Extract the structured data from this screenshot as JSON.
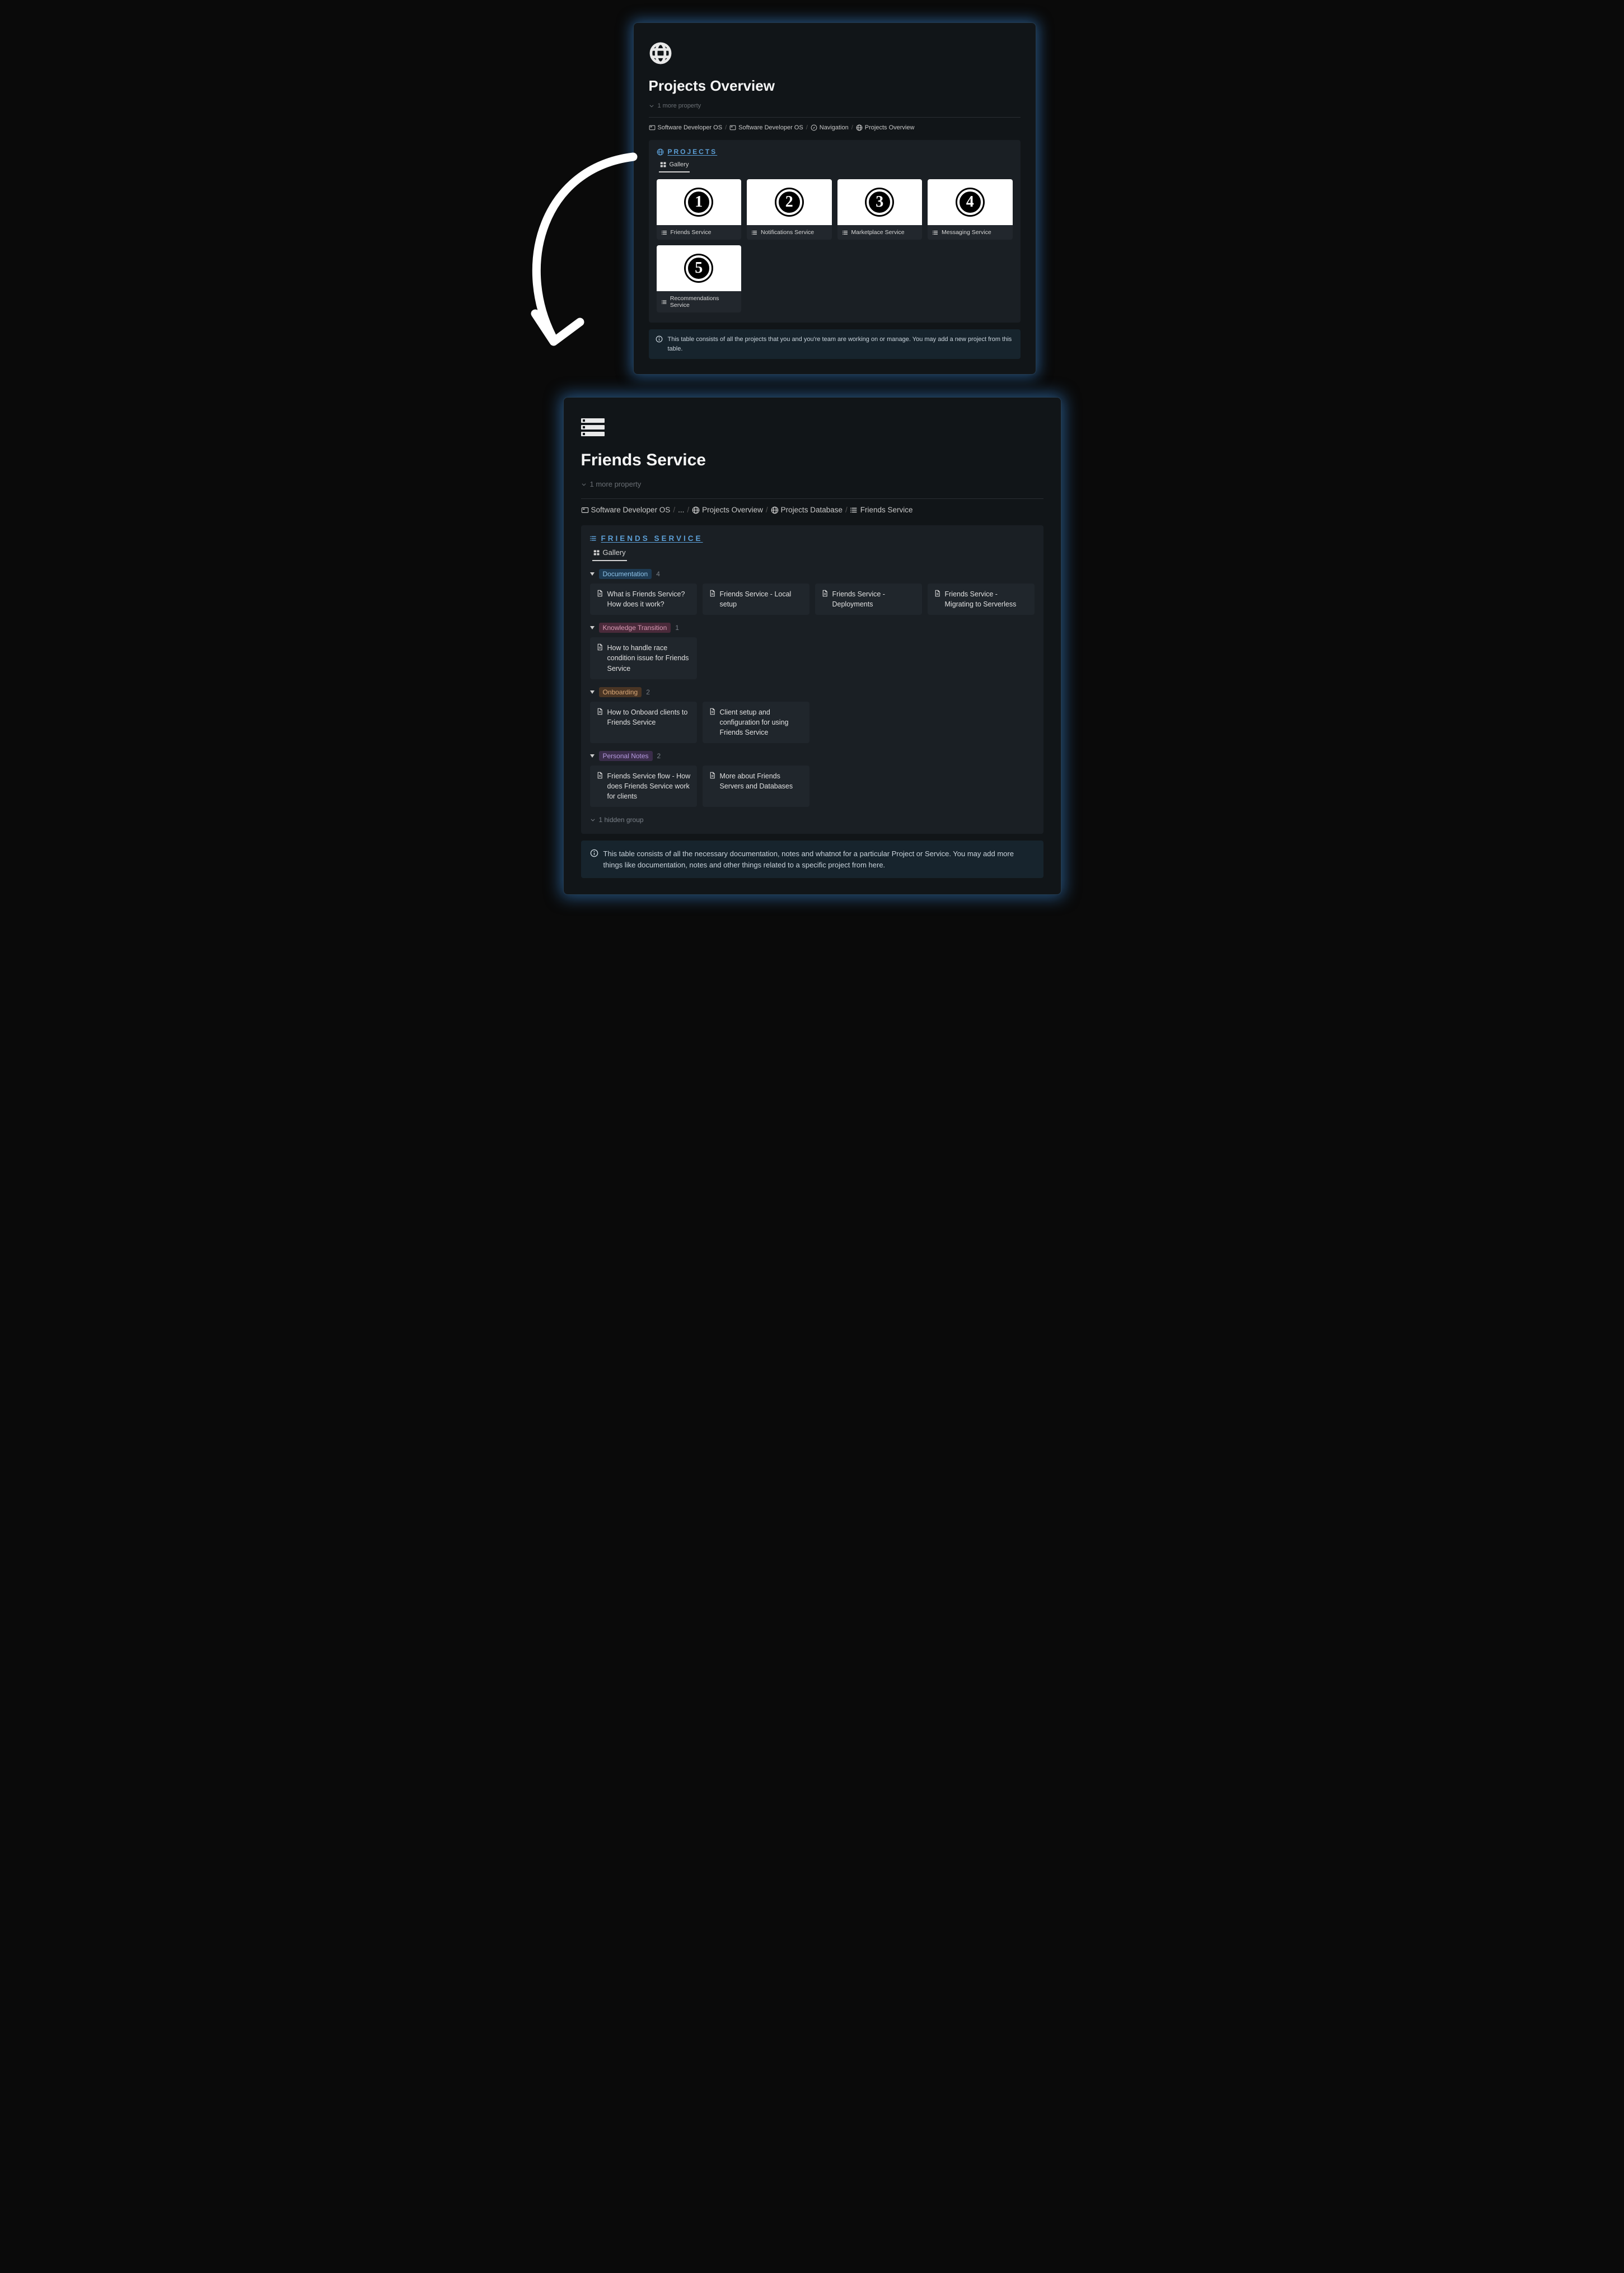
{
  "frameTop": {
    "title": "Projects Overview",
    "moreProperty": "1 more property",
    "breadcrumb": [
      {
        "label": "Software Developer OS",
        "icon": "card"
      },
      {
        "label": "Software Developer OS",
        "icon": "card"
      },
      {
        "label": "Navigation",
        "icon": "compass"
      },
      {
        "label": "Projects Overview",
        "icon": "globe"
      }
    ],
    "panelTitle": "PROJECTS",
    "tabLabel": "Gallery",
    "cards": [
      {
        "num": "1",
        "label": "Friends Service"
      },
      {
        "num": "2",
        "label": "Notifications Service"
      },
      {
        "num": "3",
        "label": "Marketplace Service"
      },
      {
        "num": "4",
        "label": "Messaging Service"
      },
      {
        "num": "5",
        "label": "Recommendations Service"
      }
    ],
    "info": "This table consists of all the projects that you and you're team are working on or manage. You may add a new project from this table."
  },
  "frameBottom": {
    "title": "Friends Service",
    "moreProperty": "1 more property",
    "breadcrumb": [
      {
        "label": "Software Developer OS",
        "icon": "card"
      },
      {
        "label": "...",
        "icon": ""
      },
      {
        "label": "Projects Overview",
        "icon": "globe"
      },
      {
        "label": "Projects Database",
        "icon": "globe"
      },
      {
        "label": "Friends Service",
        "icon": "list"
      }
    ],
    "panelTitle": "FRIENDS SERVICE",
    "tabLabel": "Gallery",
    "groups": [
      {
        "tag": "Documentation",
        "tagClass": "tag-blue",
        "count": "4",
        "items": [
          "What is Friends Service? How does it work?",
          "Friends Service - Local setup",
          "Friends Service - Deployments",
          "Friends Service - Migrating to Serverless"
        ]
      },
      {
        "tag": "Knowledge Transition",
        "tagClass": "tag-pink",
        "count": "1",
        "items": [
          "How to handle race condition issue for Friends Service"
        ]
      },
      {
        "tag": "Onboarding",
        "tagClass": "tag-orange",
        "count": "2",
        "items": [
          "How to Onboard clients to Friends Service",
          "Client setup and configuration for using Friends Service"
        ]
      },
      {
        "tag": "Personal Notes",
        "tagClass": "tag-purple",
        "count": "2",
        "items": [
          "Friends Service flow - How does Friends Service work for clients",
          "More about Friends Servers and Databases"
        ]
      }
    ],
    "hiddenGroup": "1 hidden group",
    "info": "This table consists of all the necessary documentation, notes and whatnot for a particular Project or Service. You may add more things like documentation, notes and other things related to a specific project from here."
  }
}
